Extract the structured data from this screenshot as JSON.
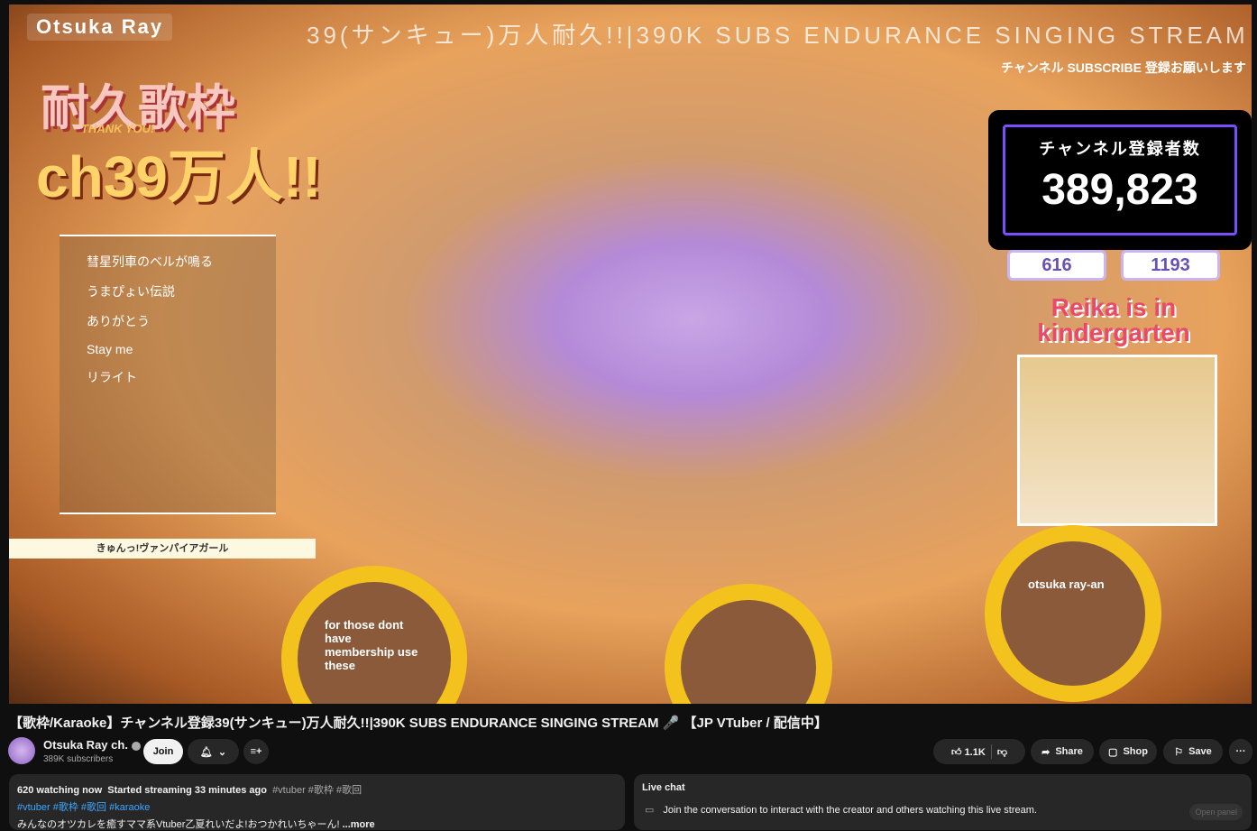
{
  "video": {
    "banner": "Otsuka Ray",
    "scroll_title": "39(サンキュー)万人耐久!!|390K SUBS ENDURANCE SINGING STREAM",
    "big_title": "耐久歌枠",
    "big_subtitle": "THANK YOU!",
    "big_count": "ch39万人!!",
    "setlist": [
      "彗星列車のベルが鳴る",
      "うまぴょい伝説",
      "ありがとう",
      "Stay me",
      "リライト"
    ],
    "now_playing": "きゅんっ!ヴァンパイアガール",
    "subscribe_prompt": "チャンネル SUBSCRIBE 登録お願いします",
    "sub_label": "チャンネル登録者数",
    "sub_count": "389,823",
    "viewers": "616",
    "likes": "1193",
    "reika": "Reika is in kindergarten",
    "flower_text": "for those dont have membership use these",
    "flower_text2": "otsuka ray-an"
  },
  "title": "【歌枠/Karaoke】チャンネル登録39(サンキュー)万人耐久!!|390K SUBS ENDURANCE SINGING STREAM 🎤 【JP VTuber / 配信中】",
  "channel": {
    "name": "Otsuka Ray ch.",
    "subscribers": "389K subscribers",
    "join_label": "Join"
  },
  "actions": {
    "likes": "1.1K",
    "share": "Share",
    "shop": "Shop",
    "save": "Save",
    "more": "···"
  },
  "description": {
    "watching": "620 watching now",
    "started": "Started streaming 33 minutes ago",
    "inline_tags": "#vtuber #歌枠 #歌回",
    "tags": "#vtuber #歌枠 #歌回 #karaoke",
    "text": "みんなのオツカレを癒すママ系Vtuber乙夏れいだよ!おつかれいちゃーん!",
    "more": "...more"
  },
  "live_chat": {
    "heading": "Live chat",
    "message": "Join the conversation to interact with the creator and others watching this live stream.",
    "open_panel": "Open panel"
  }
}
